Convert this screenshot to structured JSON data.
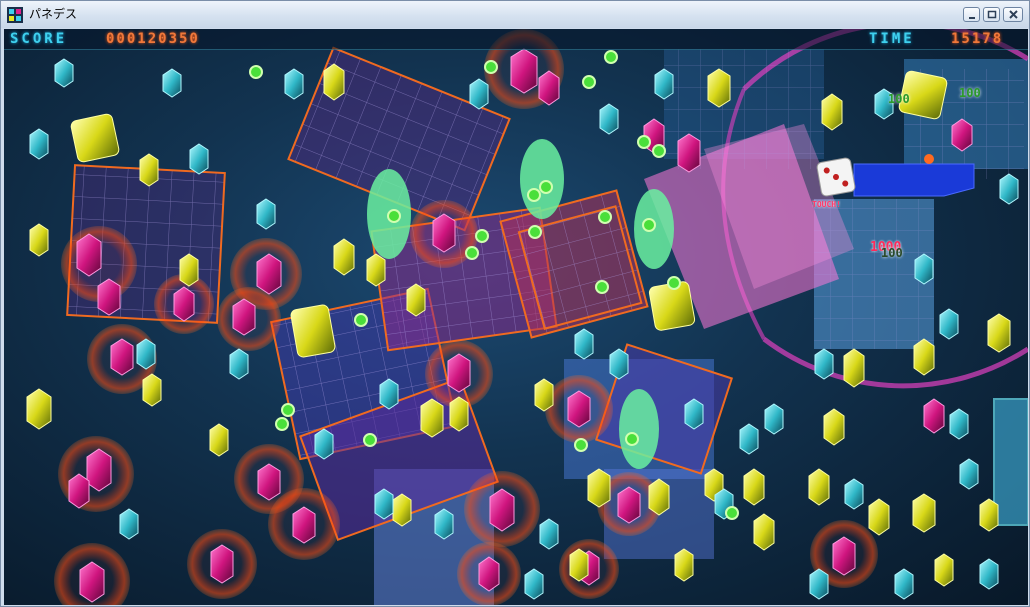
{
  "window": {
    "title": "パネデス"
  },
  "hud": {
    "score_label": "SCORE",
    "score_value": "000120350",
    "time_label": "TIME",
    "time_value": "15178"
  },
  "popups": {
    "touch_label": "TOUCH!",
    "points_a": "100",
    "points_b": "100",
    "points_c": "1000",
    "points_d": "100"
  },
  "colors": {
    "hud_label": "#3fd0ee",
    "hud_value": "#f0783a",
    "gem_magenta": "#e0208c",
    "gem_yellow": "#e8e820",
    "gem_cyan": "#38c8d8",
    "panel_outline": "#f06a20"
  }
}
